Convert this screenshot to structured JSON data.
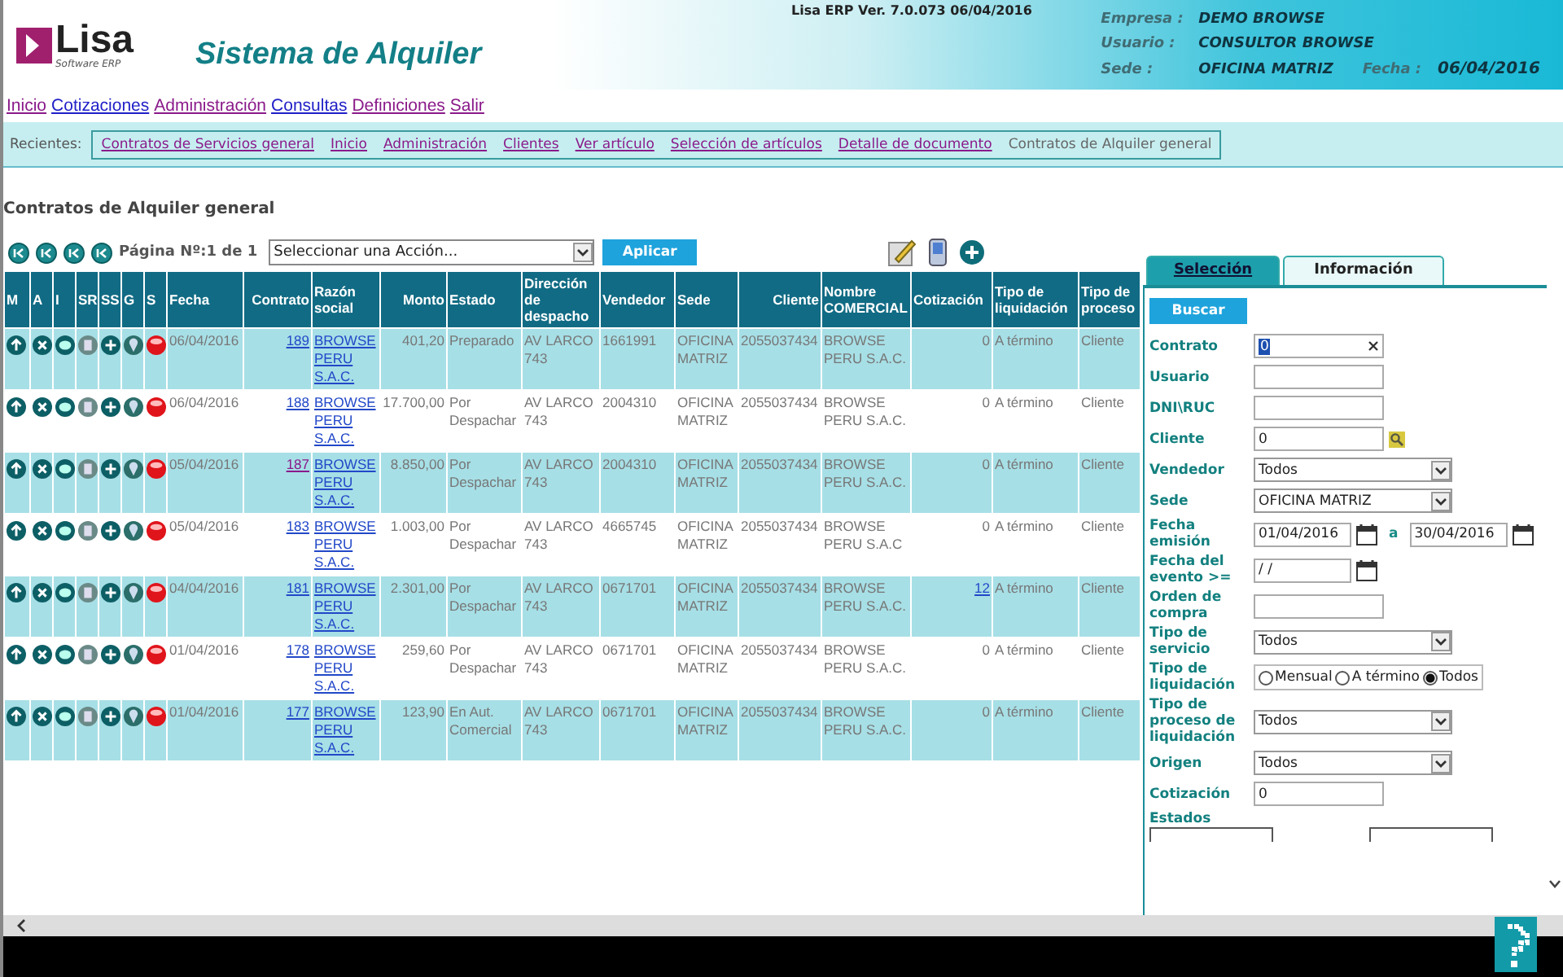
{
  "header": {
    "logo": "Lisa",
    "logo_sub": "Software ERP",
    "title": "Sistema de Alquiler",
    "version": "Lisa ERP Ver. 7.0.073 06/04/2016",
    "info": [
      {
        "label": "Empresa :",
        "value": "DEMO BROWSE"
      },
      {
        "label": "Usuario :",
        "value": "CONSULTOR BROWSE"
      },
      {
        "label": "Sede :",
        "value": "OFICINA MATRIZ",
        "extra_label": "Fecha :",
        "extra_value": "06/04/2016"
      }
    ]
  },
  "menu": [
    {
      "label": "Inicio",
      "visited": true
    },
    {
      "label": "Cotizaciones",
      "visited": false
    },
    {
      "label": "Administración",
      "visited": true
    },
    {
      "label": "Consultas",
      "visited": false
    },
    {
      "label": "Definiciones",
      "visited": true
    },
    {
      "label": "Salir",
      "visited": true
    }
  ],
  "recent": {
    "label": "Recientes:",
    "items": [
      {
        "label": "Contratos de Servicios general",
        "current": false
      },
      {
        "label": "Inicio",
        "current": false
      },
      {
        "label": "Administración",
        "current": false
      },
      {
        "label": "Clientes",
        "current": false
      },
      {
        "label": "Ver artículo",
        "current": false
      },
      {
        "label": "Selección de artículos",
        "current": false
      },
      {
        "label": "Detalle de documento",
        "current": false
      },
      {
        "label": "Contratos de Alquiler general",
        "current": true
      }
    ]
  },
  "page_title": "Contratos de Alquiler general",
  "pager": {
    "text": "Página Nº:1 de 1",
    "action": "Seleccionar una Acción...",
    "apply": "Aplicar"
  },
  "table": {
    "columns": [
      "M",
      "A",
      "I",
      "SR",
      "SS",
      "G",
      "S",
      "Fecha",
      "Contrato",
      "Razón social",
      "Monto",
      "Estado",
      "Dirección de despacho",
      "Vendedor",
      "Sede",
      "Cliente",
      "Nombre COMERCIAL",
      "Cotización",
      "Tipo de liquidación",
      "Tipo de proceso"
    ],
    "rows": [
      {
        "fecha": "06/04/2016",
        "contrato": "189",
        "visited": false,
        "razon": "BROWSE PERU S.A.C.",
        "monto": "401,20",
        "estado": "Preparado",
        "direccion": "AV LARCO 743",
        "vendedor": "1661991",
        "sede": "OFICINA MATRIZ",
        "cliente": "2055037434",
        "nombre": "BROWSE PERU S.A.C.",
        "cotizacion": "0",
        "cotizacion_link": false,
        "liquidacion": "A término",
        "proceso": "Cliente"
      },
      {
        "fecha": "06/04/2016",
        "contrato": "188",
        "visited": false,
        "razon": "BROWSE PERU S.A.C.",
        "monto": "17.700,00",
        "estado": "Por Despachar",
        "direccion": "AV LARCO 743",
        "vendedor": "2004310",
        "sede": "OFICINA MATRIZ",
        "cliente": "2055037434",
        "nombre": "BROWSE PERU S.A.C.",
        "cotizacion": "0",
        "cotizacion_link": false,
        "liquidacion": "A término",
        "proceso": "Cliente"
      },
      {
        "fecha": "05/04/2016",
        "contrato": "187",
        "visited": true,
        "razon": "BROWSE PERU S.A.C.",
        "monto": "8.850,00",
        "estado": "Por Despachar",
        "direccion": "AV LARCO 743",
        "vendedor": "2004310",
        "sede": "OFICINA MATRIZ",
        "cliente": "2055037434",
        "nombre": "BROWSE PERU S.A.C.",
        "cotizacion": "0",
        "cotizacion_link": false,
        "liquidacion": "A término",
        "proceso": "Cliente"
      },
      {
        "fecha": "05/04/2016",
        "contrato": "183",
        "visited": false,
        "razon": "BROWSE PERU S.A.C.",
        "monto": "1.003,00",
        "estado": "Por Despachar",
        "direccion": "AV LARCO 743",
        "vendedor": "4665745",
        "sede": "OFICINA MATRIZ",
        "cliente": "2055037434",
        "nombre": "BROWSE PERU S.A.C",
        "cotizacion": "0",
        "cotizacion_link": false,
        "liquidacion": "A término",
        "proceso": "Cliente"
      },
      {
        "fecha": "04/04/2016",
        "contrato": "181",
        "visited": false,
        "razon": "BROWSE PERU S.A.C.",
        "monto": "2.301,00",
        "estado": "Por Despachar",
        "direccion": "AV LARCO 743",
        "vendedor": "0671701",
        "sede": "OFICINA MATRIZ",
        "cliente": "2055037434",
        "nombre": "BROWSE PERU S.A.C.",
        "cotizacion": "12",
        "cotizacion_link": true,
        "liquidacion": "A término",
        "proceso": "Cliente"
      },
      {
        "fecha": "01/04/2016",
        "contrato": "178",
        "visited": false,
        "razon": "BROWSE PERU S.A.C.",
        "monto": "259,60",
        "estado": "Por Despachar",
        "direccion": "AV LARCO 743",
        "vendedor": "0671701",
        "sede": "OFICINA MATRIZ",
        "cliente": "2055037434",
        "nombre": "BROWSE PERU S.A.C.",
        "cotizacion": "0",
        "cotizacion_link": false,
        "liquidacion": "A término",
        "proceso": "Cliente"
      },
      {
        "fecha": "01/04/2016",
        "contrato": "177",
        "visited": false,
        "razon": "BROWSE PERU S.A.C.",
        "monto": "123,90",
        "estado": "En Aut. Comercial",
        "direccion": "AV LARCO 743",
        "vendedor": "0671701",
        "sede": "OFICINA MATRIZ",
        "cliente": "2055037434",
        "nombre": "BROWSE PERU S.A.C.",
        "cotizacion": "0",
        "cotizacion_link": false,
        "liquidacion": "A término",
        "proceso": "Cliente"
      }
    ]
  },
  "panel": {
    "tabs": [
      {
        "label": "Selección",
        "selected": true
      },
      {
        "label": "Información",
        "selected": false
      }
    ],
    "search": "Buscar",
    "fields": [
      {
        "label": "Contrato",
        "kind": "text-clear",
        "value": "0"
      },
      {
        "label": "Usuario",
        "kind": "text"
      },
      {
        "label": "DNI\\RUC",
        "kind": "text"
      },
      {
        "label": "Cliente",
        "kind": "text-lookup",
        "value": "0"
      },
      {
        "label": "Vendedor",
        "kind": "select",
        "value": "Todos"
      },
      {
        "label": "Sede",
        "kind": "select",
        "value": "OFICINA MATRIZ"
      },
      {
        "label": "Fecha emisión",
        "kind": "daterange",
        "value": "01/04/2016",
        "joiner": "a",
        "value2": "30/04/2016"
      },
      {
        "label": "Fecha del evento >=",
        "kind": "date",
        "value": " / /"
      },
      {
        "label": "Orden de compra",
        "kind": "text"
      },
      {
        "label": "Tipo de servicio",
        "kind": "select",
        "value": "Todos"
      },
      {
        "label": "Tipo de liquidación",
        "kind": "radio",
        "options": [
          {
            "label": "Mensual",
            "selected": false
          },
          {
            "label": "A término",
            "selected": false
          },
          {
            "label": "Todos",
            "selected": true
          }
        ]
      },
      {
        "label": "Tipo de proceso de liquidación",
        "kind": "select",
        "value": "Todos"
      },
      {
        "label": "Origen",
        "kind": "select",
        "value": "Todos"
      },
      {
        "label": "Cotización",
        "kind": "text",
        "value": "0"
      },
      {
        "label": "Estados",
        "kind": "heading"
      }
    ]
  }
}
